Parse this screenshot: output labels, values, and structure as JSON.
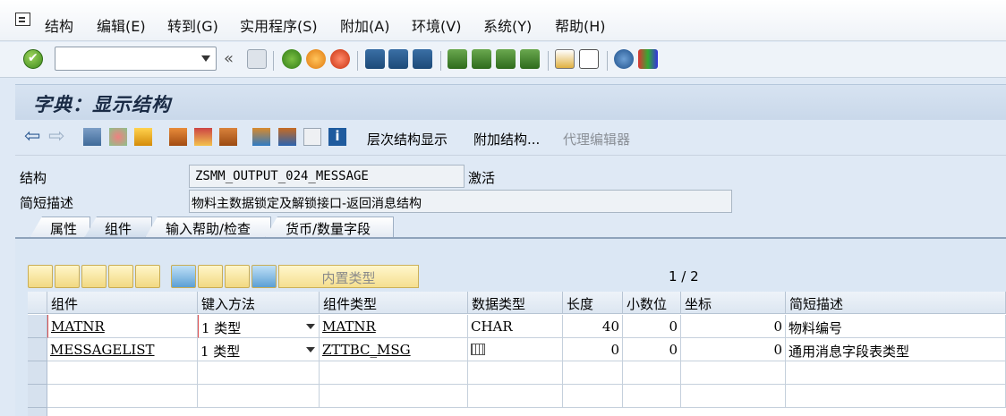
{
  "menu": [
    "结构",
    "编辑(E)",
    "转到(G)",
    "实用程序(S)",
    "附加(A)",
    "环境(V)",
    "系统(Y)",
    "帮助(H)"
  ],
  "title": "字典：显示结构",
  "app_toolbar": {
    "hierarchy": "层次结构显示",
    "append": "附加结构...",
    "proxy": "代理编辑器"
  },
  "form": {
    "structure_label": "结构",
    "structure_value": "ZSMM_OUTPUT_024_MESSAGE",
    "status": "激活",
    "desc_label": "简短描述",
    "desc_value": "物料主数据锁定及解锁接口-返回消息结构"
  },
  "tabs": [
    "属性",
    "组件",
    "输入帮助/检查",
    "货币/数量字段"
  ],
  "active_tab": "组件",
  "builtin_type": "内置类型",
  "pager": "1 / 2",
  "columns": [
    "组件",
    "键入方法",
    "组件类型",
    "数据类型",
    "长度",
    "小数位",
    "坐标",
    "简短描述"
  ],
  "rows": [
    {
      "component": "MATNR",
      "typing": "1 类型",
      "comp_type": "MATNR",
      "data_type": "CHAR",
      "length": "40",
      "decimals": "0",
      "coord": "0",
      "desc": "物料编号"
    },
    {
      "component": "MESSAGELIST",
      "typing": "1 类型",
      "comp_type": "ZTTBC_MSG",
      "data_type": "",
      "length": "0",
      "decimals": "0",
      "coord": "0",
      "desc": "通用消息字段表类型"
    }
  ]
}
